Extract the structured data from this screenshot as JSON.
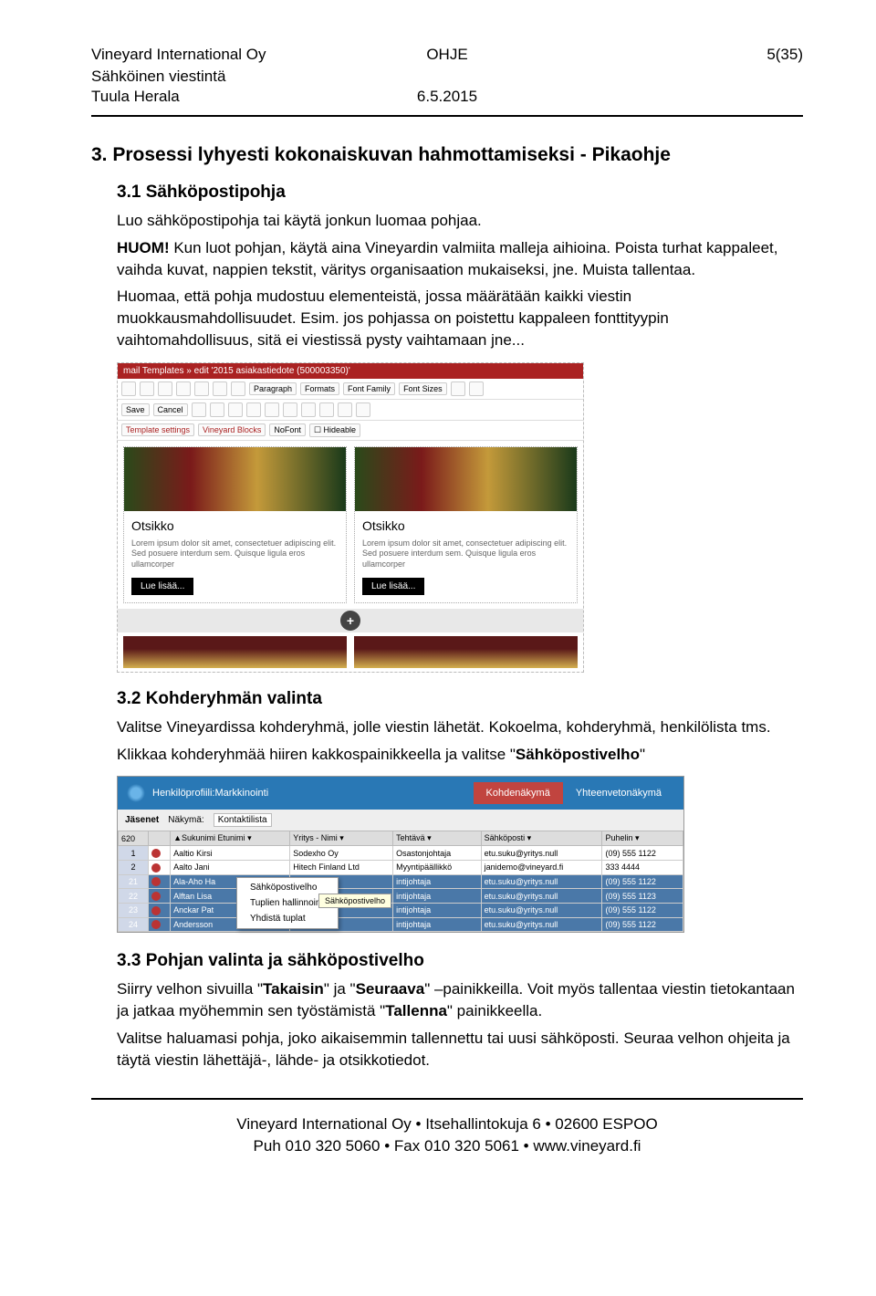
{
  "header": {
    "company": "Vineyard International Oy",
    "doctype": "OHJE",
    "page": "5(35)",
    "dept": "Sähköinen viestintä",
    "author": "Tuula Herala",
    "date": "6.5.2015"
  },
  "sec3": {
    "title": "3. Prosessi lyhyesti kokonaiskuvan hahmottamiseksi - Pikaohje",
    "s31": {
      "title": "3.1 Sähköpostipohja",
      "p1": "Luo sähköpostipohja tai käytä jonkun luomaa pohjaa.",
      "p2a": "HUOM!",
      "p2b": " Kun luot pohjan, käytä aina Vineyardin valmiita malleja aihioina. Poista turhat kappaleet, vaihda kuvat, nappien tekstit, väritys organisaation mukaiseksi, jne. Muista tallentaa.",
      "p3": "Huomaa, että pohja mudostuu elementeistä, jossa määrätään kaikki viestin muokkausmahdollisuudet. Esim. jos pohjassa on poistettu kappaleen fonttityypin vaihtomahdollisuus, sitä ei viestissä pysty vaihtamaan jne..."
    },
    "ss1": {
      "title_bar": "mail Templates » edit '2015 asiakastiedote (500003350)'",
      "tb2": {
        "save": "Save",
        "cancel": "Cancel"
      },
      "tb3": {
        "tpl": "Template settings",
        "vb": "Vineyard Blocks",
        "nf": "NoFont",
        "hide": "Hideable"
      },
      "tb1": {
        "para": "Paragraph",
        "formats": "Formats",
        "fontfam": "Font Family",
        "fontsize": "Font Sizes"
      },
      "col_title": "Otsikko",
      "col_text": "Lorem ipsum dolor sit amet, consectetuer adipiscing elit. Sed posuere interdum sem. Quisque ligula eros ullamcorper",
      "readmore": "Lue lisää..."
    },
    "s32": {
      "title": "3.2 Kohderyhmän valinta",
      "p1": "Valitse Vineyardissa kohderyhmä, jolle viestin lähetät. Kokoelma, kohderyhmä, henkilölista tms.",
      "p2a": "Klikkaa kohderyhmää hiiren kakkospainikkeella ja valitse \"",
      "p2b": "Sähköpostivelho",
      "p2c": "\""
    },
    "ss2": {
      "topbar": "Henkilöprofiili:Markkinointi",
      "tab1": "Kohdenäkymä",
      "tab2": "Yhteenvetonäkymä",
      "sub": {
        "jasenet": "Jäsenet",
        "nakyma": "Näkymä:",
        "kontakti": "Kontaktilista"
      },
      "headers": [
        "620",
        "Sukunimi Etunimi",
        "Yritys - Nimi",
        "Tehtävä",
        "Sähköposti",
        "Puhelin"
      ],
      "rows": [
        {
          "n": "1",
          "name": "Aaltio Kirsi",
          "co": "Sodexho Oy",
          "role": "Osastonjohtaja",
          "email": "etu.suku@yritys.null",
          "tel": "(09) 555 1122",
          "sel": false
        },
        {
          "n": "2",
          "name": "Aalto Jani",
          "co": "Hitech Finland Ltd",
          "role": "Myyntipäällikkö",
          "email": "janidemo@vineyard.fi",
          "tel": "333 4444",
          "sel": false
        },
        {
          "n": "21",
          "name": "Ala-Aho Ha",
          "co": "",
          "role": "intijohtaja",
          "email": "etu.suku@yritys.null",
          "tel": "(09) 555 1122",
          "sel": true
        },
        {
          "n": "22",
          "name": "Alftan Lisa",
          "co": "",
          "role": "intijohtaja",
          "email": "etu.suku@yritys.null",
          "tel": "(09) 555 1123",
          "sel": true
        },
        {
          "n": "23",
          "name": "Anckar Pat",
          "co": "",
          "role": "intijohtaja",
          "email": "etu.suku@yritys.null",
          "tel": "(09) 555 1122",
          "sel": true
        },
        {
          "n": "24",
          "name": "Andersson",
          "co": "",
          "role": "intijohtaja",
          "email": "etu.suku@yritys.null",
          "tel": "(09) 555 1122",
          "sel": true
        }
      ],
      "ctx": {
        "i1": "Sähköpostivelho",
        "i2": "Tuplien hallinnointi",
        "i3": "Yhdistä tuplat",
        "tip": "Sähköpostivelho"
      }
    },
    "s33": {
      "title": "3.3 Pohjan valinta ja sähköpostivelho",
      "p1a": "Siirry velhon sivuilla \"",
      "p1b": "Takaisin",
      "p1c": "\" ja \"",
      "p1d": "Seuraava",
      "p1e": "\" –painikkeilla. Voit myös tallentaa viestin tietokantaan ja jatkaa myöhemmin sen työstämistä \"",
      "p1f": "Tallenna",
      "p1g": "\" painikkeella.",
      "p2": "Valitse haluamasi pohja, joko aikaisemmin tallennettu tai uusi sähköposti. Seuraa velhon ohjeita ja täytä viestin lähettäjä-, lähde- ja otsikkotiedot."
    }
  },
  "footer": {
    "l1": "Vineyard International Oy • Itsehallintokuja 6 • 02600 ESPOO",
    "l2": "Puh 010 320 5060 • Fax 010 320 5061 • www.vineyard.fi"
  }
}
